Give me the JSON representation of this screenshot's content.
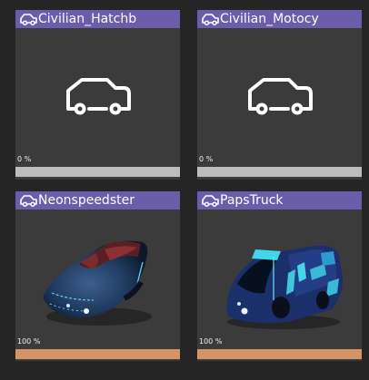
{
  "colors": {
    "background": "#252525",
    "card": "#3b3b3b",
    "header": "#6c5cac",
    "progress_track": "#bdbdbd",
    "progress_done": "#d59466"
  },
  "assets": [
    {
      "name": "Civilian_Hatchb",
      "progress_label": "0 %",
      "progress": 0,
      "preview": "placeholder-car-icon"
    },
    {
      "name": "Civilian_Motocy",
      "progress_label": "0 %",
      "progress": 0,
      "preview": "placeholder-car-icon"
    },
    {
      "name": "Neonspeedster",
      "progress_label": "100 %",
      "progress": 1,
      "preview": "neon-speedster-render"
    },
    {
      "name": "PapsTruck",
      "progress_label": "100 %",
      "progress": 1,
      "preview": "paps-truck-render"
    }
  ]
}
